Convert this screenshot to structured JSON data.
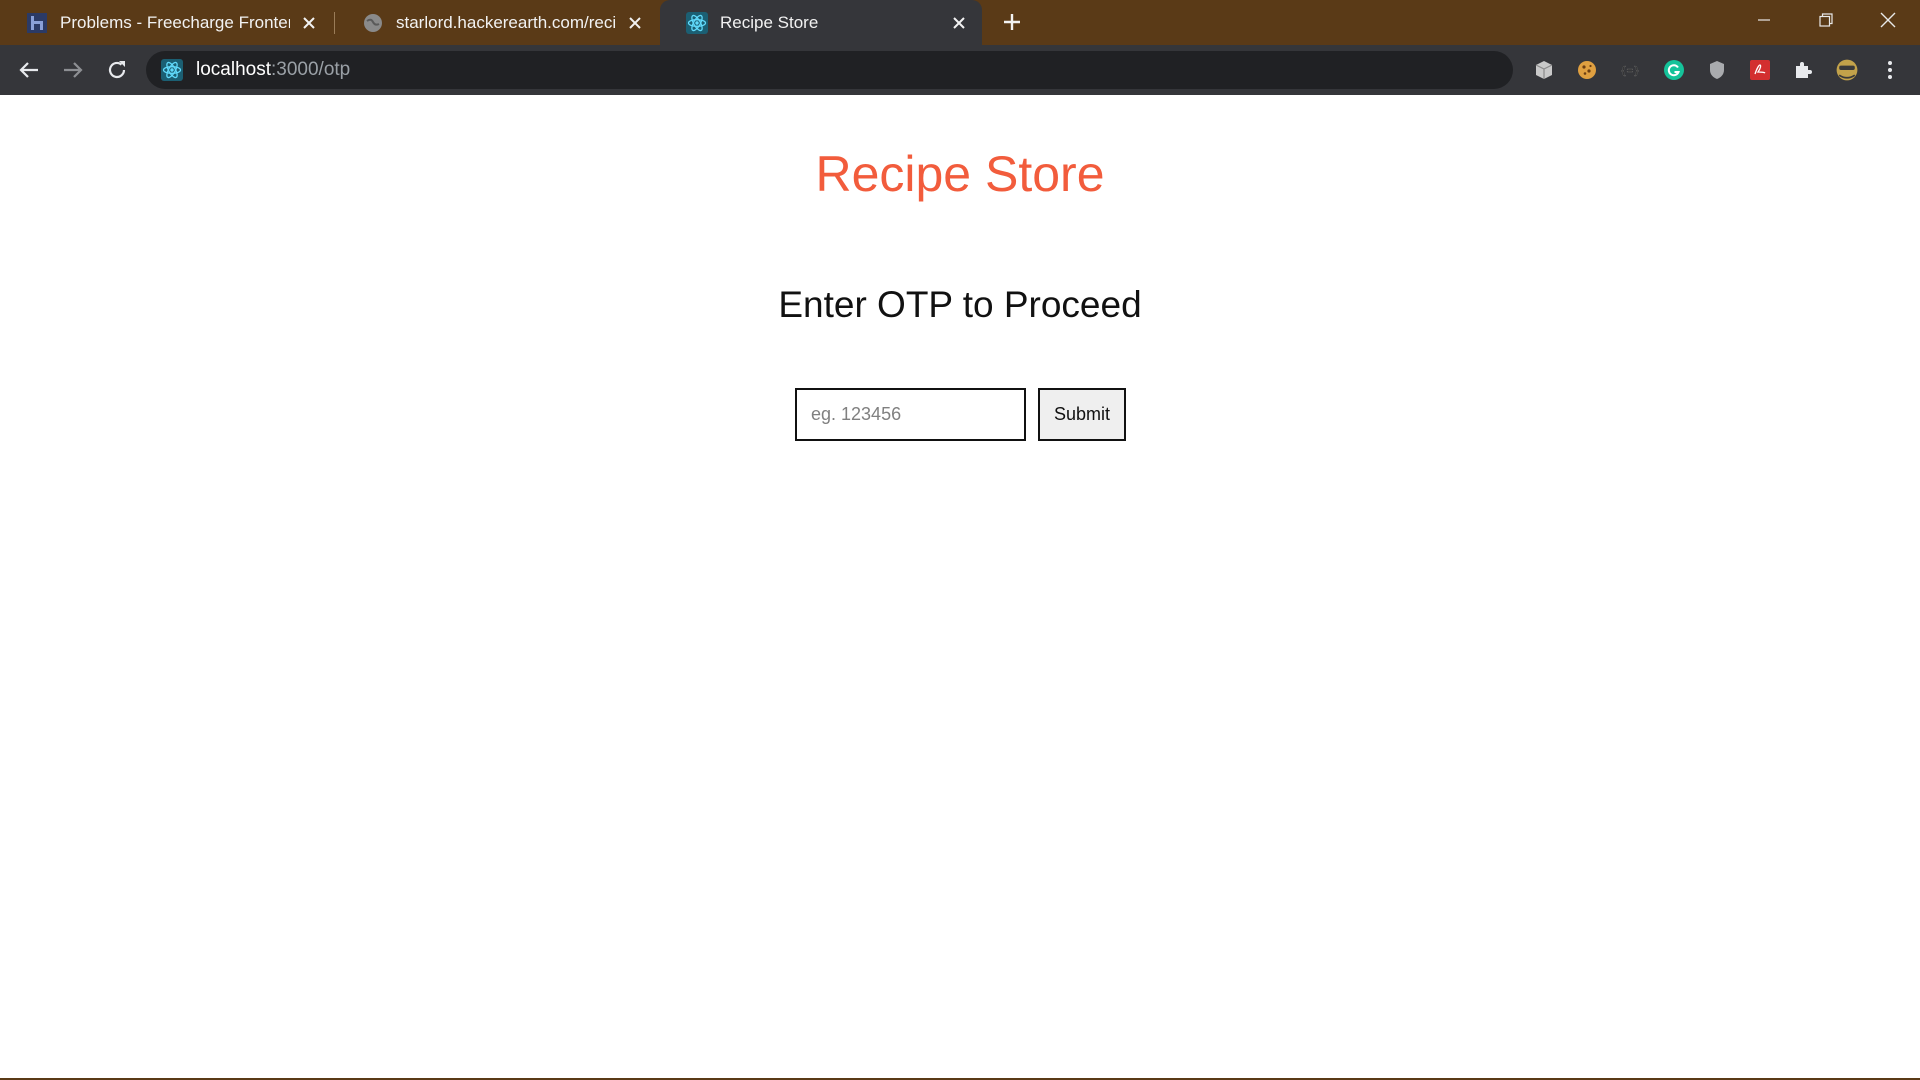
{
  "browser": {
    "tabs": [
      {
        "title": "Problems - Freecharge Frontend",
        "favicon": "hackerearth-icon",
        "active": false
      },
      {
        "title": "starlord.hackerearth.com/recipe",
        "favicon": "globe-icon",
        "active": false
      },
      {
        "title": "Recipe Store",
        "favicon": "react-icon",
        "active": true
      }
    ],
    "url": {
      "host": "localhost",
      "path": ":3000/otp"
    },
    "extensions": [
      "cube-icon",
      "cookie-icon",
      "braces-icon",
      "grammarly-icon",
      "shield-icon",
      "pdf-icon",
      "puzzle-icon",
      "avatar-icon",
      "menu-icon"
    ],
    "colors": {
      "frame": "#5a3a17",
      "toolbar": "#35363a",
      "omnibox": "#202124"
    }
  },
  "page": {
    "brand_title": "Recipe Store",
    "heading": "Enter OTP to Proceed",
    "otp_input": {
      "placeholder": "eg. 123456",
      "value": ""
    },
    "submit_label": "Submit",
    "colors": {
      "brand": "#f25c3c"
    }
  }
}
